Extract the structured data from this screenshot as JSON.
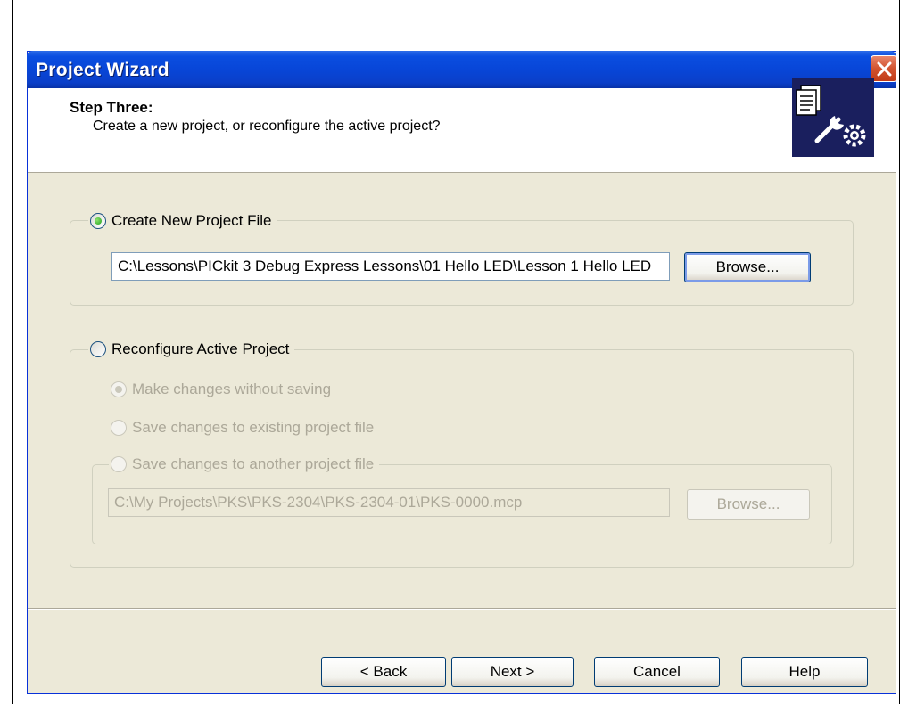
{
  "window": {
    "title": "Project Wizard"
  },
  "header": {
    "step_title": "Step Three:",
    "step_description": "Create a new project, or reconfigure the active project?"
  },
  "create_new": {
    "label": "Create New Project File",
    "selected": true,
    "path_value": "C:\\Lessons\\PICkit 3 Debug Express Lessons\\01 Hello LED\\Lesson 1 Hello LED",
    "browse_label": "Browse..."
  },
  "reconfigure": {
    "label": "Reconfigure Active Project",
    "selected": false,
    "options": [
      {
        "label": "Make changes without saving",
        "selected": true
      },
      {
        "label": "Save changes to existing project file",
        "selected": false
      },
      {
        "label": "Save changes to another project file",
        "selected": false
      }
    ],
    "path_value": "C:\\My Projects\\PKS\\PKS-2304\\PKS-2304-01\\PKS-0000.mcp",
    "browse_label": "Browse..."
  },
  "footer": {
    "back_label": "< Back",
    "next_label": "Next >",
    "cancel_label": "Cancel",
    "help_label": "Help"
  },
  "icons": {
    "close": "close-icon",
    "wizard": "document-wrench-gear-icon"
  },
  "colors": {
    "titlebar": "#0846d8",
    "dialog_bg": "#ece9d8",
    "disabled_text": "#aca899"
  }
}
